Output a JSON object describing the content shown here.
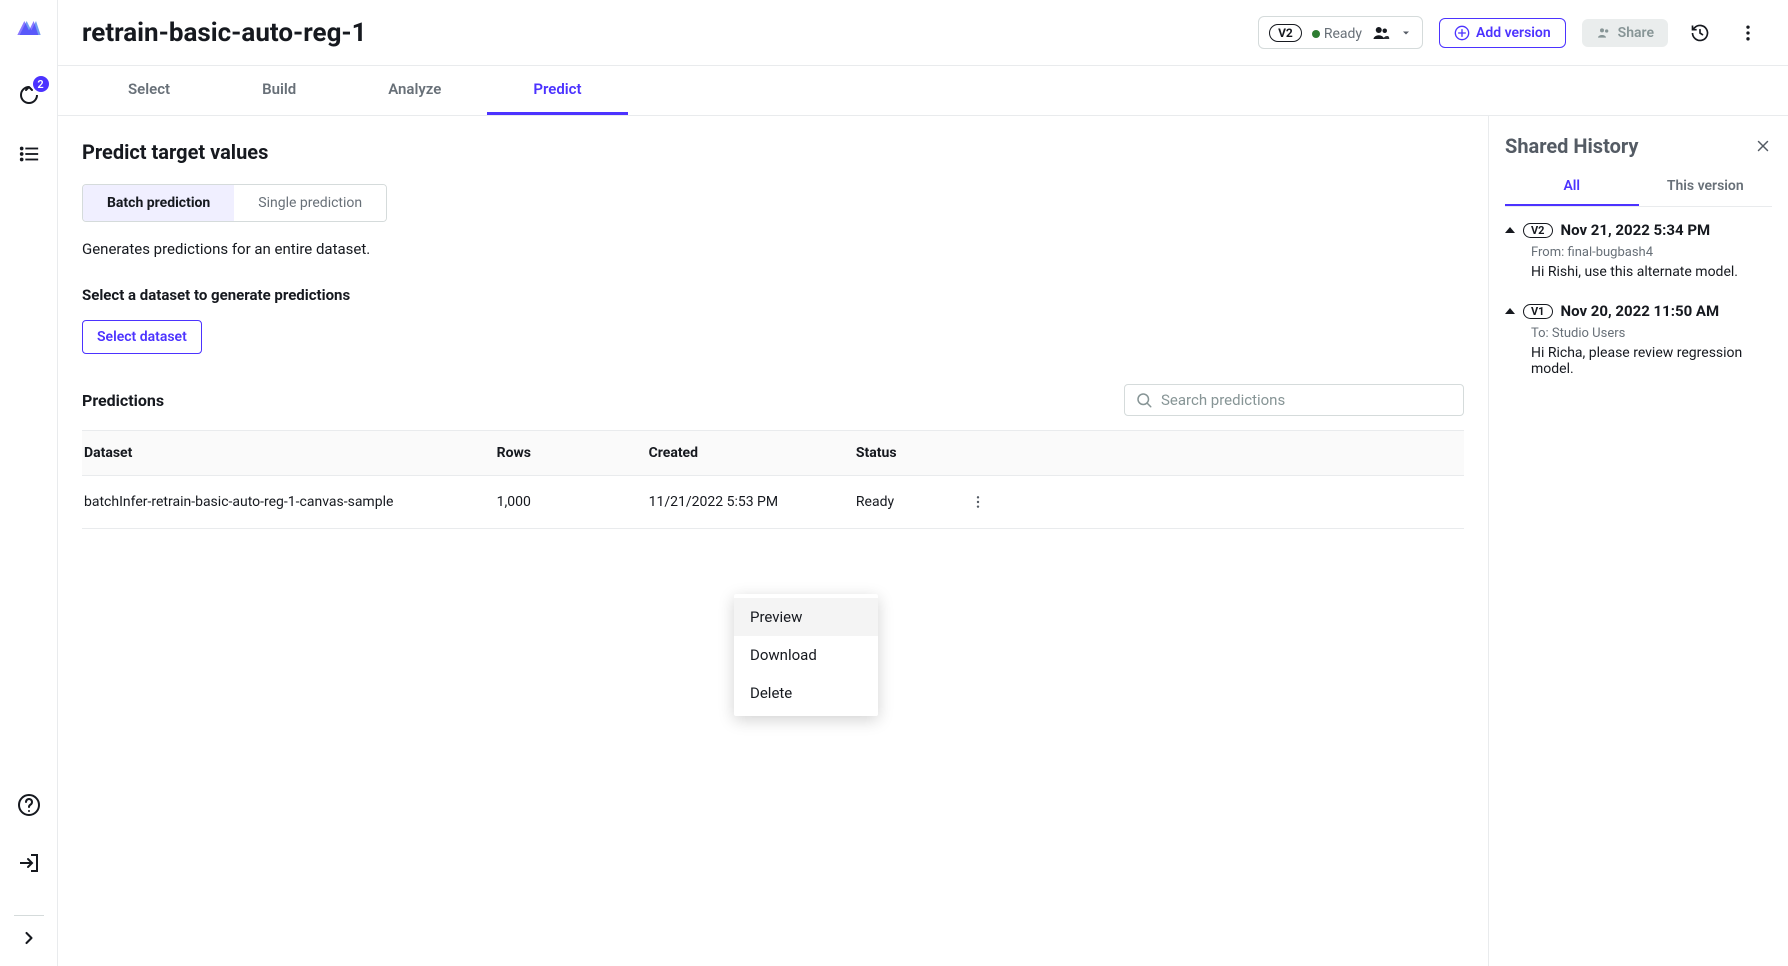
{
  "leftRail": {
    "badge": "2"
  },
  "header": {
    "title": "retrain-basic-auto-reg-1",
    "version_badge": "V2",
    "status": "Ready",
    "add_version_label": "Add version",
    "share_label": "Share"
  },
  "tabs": [
    {
      "label": "Select"
    },
    {
      "label": "Build"
    },
    {
      "label": "Analyze"
    },
    {
      "label": "Predict",
      "active": true
    }
  ],
  "predict": {
    "title": "Predict target values",
    "toggle": {
      "batch": "Batch prediction",
      "single": "Single prediction"
    },
    "description": "Generates predictions for an entire dataset.",
    "select_heading": "Select a dataset to generate predictions",
    "select_button": "Select dataset",
    "predictions_heading": "Predictions",
    "search_placeholder": "Search predictions",
    "columns": {
      "dataset": "Dataset",
      "rows": "Rows",
      "created": "Created",
      "status": "Status"
    },
    "rows": [
      {
        "dataset": "batchInfer-retrain-basic-auto-reg-1-canvas-sample",
        "rows": "1,000",
        "created": "11/21/2022 5:53 PM",
        "status": "Ready"
      }
    ],
    "row_menu": {
      "preview": "Preview",
      "download": "Download",
      "delete": "Delete"
    }
  },
  "history_panel": {
    "title": "Shared History",
    "tabs": {
      "all": "All",
      "this": "This version"
    },
    "items": [
      {
        "v": "V2",
        "date": "Nov 21, 2022 5:34 PM",
        "meta": "From: final-bugbash4",
        "msg": "Hi Rishi, use this alternate model."
      },
      {
        "v": "V1",
        "date": "Nov 20, 2022 11:50 AM",
        "meta": "To: Studio Users",
        "msg": "Hi Richa, please review regression model."
      }
    ]
  }
}
